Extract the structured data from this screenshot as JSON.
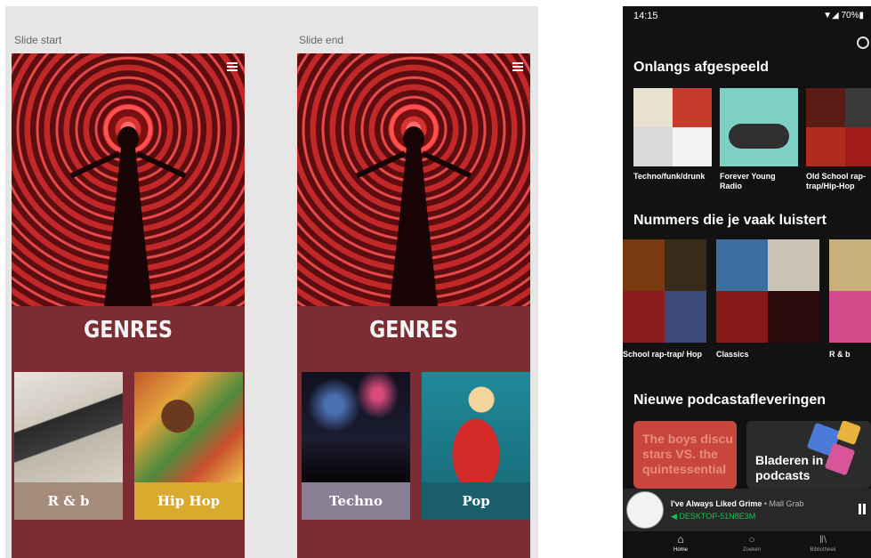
{
  "canvas": {
    "labels": {
      "start": "Slide start",
      "end": "Slide end"
    },
    "slides": [
      {
        "title": "GENRES",
        "tiles": [
          {
            "label": "R & b",
            "color": "#a48b7a"
          },
          {
            "label": "Hip Hop",
            "color": "#d9aa2e"
          }
        ]
      },
      {
        "title": "GENRES",
        "tiles": [
          {
            "label": "Techno",
            "color": "#8a8096"
          },
          {
            "label": "Pop",
            "color": "#1b5e6b"
          }
        ]
      }
    ]
  },
  "phone": {
    "status": {
      "time": "14:15",
      "right": "▼◢ 70%▮"
    },
    "sections": {
      "recent": {
        "title": "Onlangs afgespeeld",
        "items": [
          {
            "caption": "Techno/funk/drunk"
          },
          {
            "caption": "Forever Young Radio"
          },
          {
            "caption": "Old School rap-trap/Hip-Hop"
          }
        ]
      },
      "frequent": {
        "title": "Nummers die je vaak luistert",
        "items": [
          {
            "caption": "School rap-trap/ Hop"
          },
          {
            "caption": "Classics"
          },
          {
            "caption": "R & b"
          }
        ]
      },
      "podcasts": {
        "title": "Nieuwe podcastafleveringen",
        "cards": [
          {
            "text": "The boys discu stars VS. the quintessential",
            "color": "#c9463d"
          },
          {
            "text": "Bladeren in podcasts",
            "color": "#2b2b2b"
          }
        ]
      }
    },
    "player": {
      "track": "I've Always Liked Grime",
      "separator": " • ",
      "artist": "Mall Grab",
      "device": "DESKTOP-51N8E3M"
    },
    "tabs": [
      {
        "label": "Home",
        "icon": "home-icon"
      },
      {
        "label": "Zoeken",
        "icon": "search-icon"
      },
      {
        "label": "Bibliotheek",
        "icon": "library-icon"
      }
    ],
    "colors": {
      "accent": "#1db954",
      "background": "#121212"
    }
  }
}
